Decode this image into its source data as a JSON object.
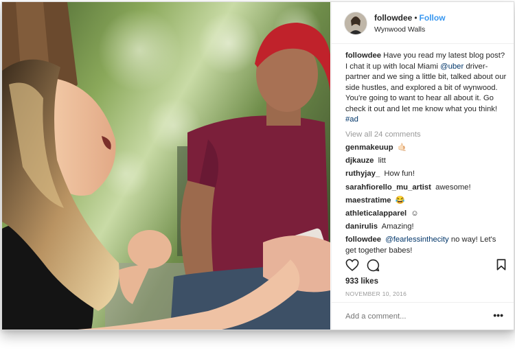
{
  "post": {
    "username": "followdee",
    "separator": "•",
    "follow_label": "Follow",
    "location": "Wynwood Walls"
  },
  "caption": {
    "username": "followdee",
    "text_1": "Have you read my latest blog post? I chat it up with local Miami ",
    "mention": "@uber",
    "text_2": " driver-partner and we sing a little bit, talked about our side hustles, and explored a bit of wynwood. You're going to want to hear all about it. Go check it out and let me know what you think! ",
    "hashtag": "#ad"
  },
  "view_all_label": "View all 24 comments",
  "comments": [
    {
      "username": "genmakeuup",
      "text": "🤙🏻"
    },
    {
      "username": "djkauze",
      "text": "litt"
    },
    {
      "username": "ruthyjay_",
      "text": "How fun!"
    },
    {
      "username": "sarahfiorello_mu_artist",
      "text": "awesome!"
    },
    {
      "username": "maestratime",
      "text": "😂"
    },
    {
      "username": "athleticalapparel",
      "text": "☺"
    },
    {
      "username": "danirulis",
      "text": "Amazing!"
    }
  ],
  "reply": {
    "username": "followdee",
    "mention": "@fearlessinthecity",
    "text": " no way! Let's get together babes!"
  },
  "likes_label": "933 likes",
  "date_label": "NOVEMBER 10, 2016",
  "add_comment_placeholder": "Add a comment...",
  "more_label": "•••",
  "icons": [
    "heart-icon",
    "comment-icon",
    "bookmark-icon"
  ],
  "colors": {
    "link": "#3897f0",
    "mention": "#003569",
    "muted": "#999999"
  }
}
